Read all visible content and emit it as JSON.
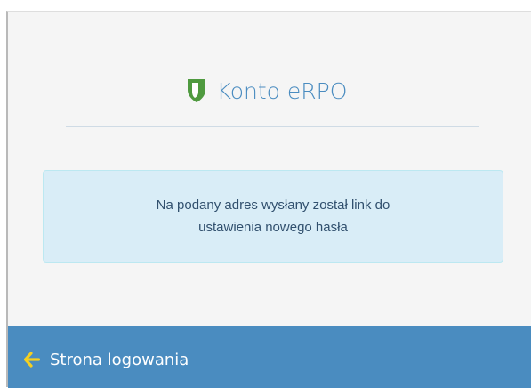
{
  "header": {
    "title": "Konto eRPO",
    "logo_icon": "shield-icon"
  },
  "alert": {
    "message": "Na podany adres wysłany został link do\nustawienia nowego hasła"
  },
  "footer": {
    "back_link_label": "Strona logowania",
    "back_icon": "arrow-left-icon"
  },
  "colors": {
    "brand_blue": "#4a8cc0",
    "shield_green": "#4f9a3f",
    "arrow_yellow": "#f5d020",
    "alert_bg": "#d9edf7",
    "panel_bg": "#f5f5f5"
  }
}
